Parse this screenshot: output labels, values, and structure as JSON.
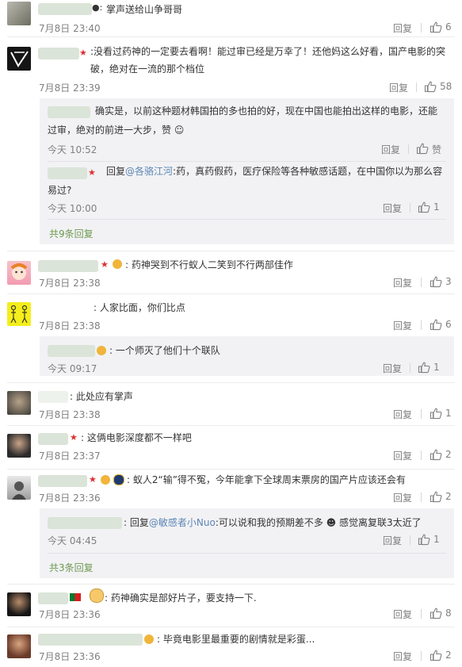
{
  "reply_label": "回复",
  "comments": {
    "c1": {
      "text": "掌声送给山争哥哥",
      "time": "7月8日 23:40",
      "likes": "6"
    },
    "c2": {
      "text": "没看过药神的一定要去看啊！能过审已经是万幸了！还他妈这么好看，国产电影的突破，绝对在一流的那个档位",
      "time": "7月8日 23:39",
      "likes": "58",
      "replies": [
        {
          "text": "确实是，以前这种题材韩国拍的多也拍的好，现在中国也能拍出这样的电影，还能过审，绝对的前进一大步，赞",
          "time": "今天 10:52",
          "likes": "赞"
        },
        {
          "prefix": "回复",
          "mention": "@各骆江河",
          "text": ":药，真药假药，医疗保险等各种敏感话题，在中国你以为那么容易过?",
          "time": "今天 10:00",
          "likes": "1"
        }
      ],
      "more": "共9条回复"
    },
    "c3": {
      "text": "药神哭到不行蚁人二笑到不行两部佳作",
      "time": "7月8日 23:38",
      "likes": "3"
    },
    "c4": {
      "text": "人家比面，你们比点",
      "time": "7月8日 23:38",
      "likes": "6",
      "replies": [
        {
          "text": "一个师灭了他们十个联队",
          "time": "今天 09:17",
          "likes": "1"
        }
      ]
    },
    "c5": {
      "text": "此处应有掌声",
      "time": "7月8日 23:38",
      "likes": "1"
    },
    "c6": {
      "text": "这俩电影深度都不一样吧",
      "time": "7月8日 23:37",
      "likes": "2"
    },
    "c7": {
      "text": "蚁人2“输”得不冤，今年能拿下全球周末票房的国产片应该还会有",
      "time": "7月8日 23:36",
      "likes": "2",
      "replies": [
        {
          "prefix": "回复",
          "mention": "@敏感者小Nuo",
          "text": ":可以说和我的预期差不多",
          "text2": "感觉离复联3太近了",
          "time": "今天 04:45",
          "likes": "1"
        }
      ],
      "more": "共3条回复"
    },
    "c8": {
      "text": "药神确实是部好片子，要支持一下.",
      "time": "7月8日 23:36",
      "likes": "8"
    },
    "c9": {
      "text": "毕竟电影里最重要的剧情就是彩蛋...",
      "time": "7月8日 23:36",
      "likes": "2"
    }
  },
  "colors": {
    "link": "#5d86b3",
    "more_link": "#6f9a52",
    "vip_star": "#e03030",
    "reply_bg": "#f2f2f5"
  }
}
